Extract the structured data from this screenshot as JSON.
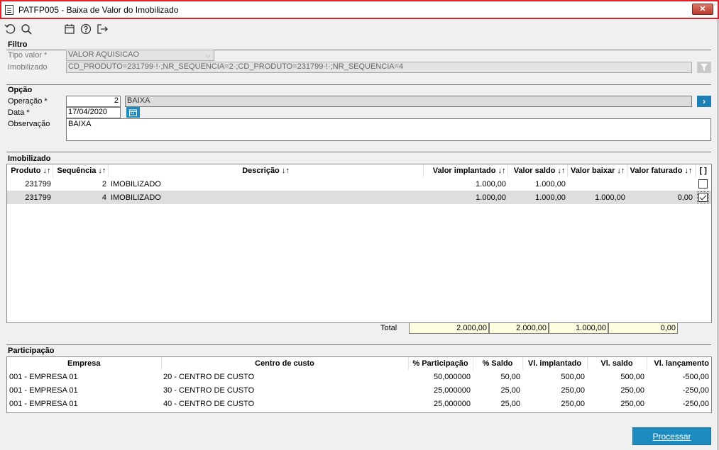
{
  "window": {
    "title": "PATFP005 - Baixa de Valor do Imobilizado",
    "close_label": "✕"
  },
  "toolbar": {
    "icons": [
      "undo-icon",
      "search-icon",
      "calendar-icon",
      "help-icon",
      "exit-icon"
    ]
  },
  "filtro": {
    "section_title": "Filtro",
    "tipo_valor_label": "Tipo valor *",
    "tipo_valor_value": "VALOR AQUISICAO",
    "imobilizado_label": "Imobilizado",
    "imobilizado_value": "CD_PRODUTO=231799·!·;NR_SEQUENCIA=2·;CD_PRODUTO=231799·!·;NR_SEQUENCIA=4"
  },
  "opcao": {
    "section_title": "Opção",
    "operacao_label": "Operação *",
    "operacao_code": "2",
    "operacao_desc": "BAIXA",
    "data_label": "Data *",
    "data_value": "17/04/2020",
    "observacao_label": "Observação",
    "observacao_value": "BAIXA"
  },
  "imobilizado": {
    "section_title": "Imobilizado",
    "columns": [
      "Produto ↓↑",
      "Sequência ↓↑",
      "Descrição ↓↑",
      "Valor implantado ↓↑",
      "Valor saldo ↓↑",
      "Valor baixar ↓↑",
      "Valor faturado ↓↑",
      "[ ]"
    ],
    "rows": [
      {
        "produto": "231799",
        "sequencia": "2",
        "descricao": "IMOBILIZADO",
        "valor_implantado": "1.000,00",
        "valor_saldo": "1.000,00",
        "valor_baixar": "",
        "valor_faturado": "",
        "checked": false
      },
      {
        "produto": "231799",
        "sequencia": "4",
        "descricao": "IMOBILIZADO",
        "valor_implantado": "1.000,00",
        "valor_saldo": "1.000,00",
        "valor_baixar": "1.000,00",
        "valor_faturado": "0,00",
        "checked": true
      }
    ],
    "total_label": "Total",
    "totals": [
      "2.000,00",
      "2.000,00",
      "1.000,00",
      "0,00"
    ]
  },
  "participacao": {
    "section_title": "Participação",
    "columns": [
      "Empresa",
      "Centro de custo",
      "% Participação",
      "% Saldo",
      "Vl. implantado",
      "Vl. saldo",
      "Vl. lançamento"
    ],
    "rows": [
      {
        "empresa": "001 - EMPRESA 01",
        "centro": "20 - CENTRO DE CUSTO",
        "participacao": "50,000000",
        "saldo_pct": "50,00",
        "implantado": "500,00",
        "saldo": "500,00",
        "lancamento": "-500,00"
      },
      {
        "empresa": "001 - EMPRESA 01",
        "centro": "30 - CENTRO DE CUSTO",
        "participacao": "25,000000",
        "saldo_pct": "25,00",
        "implantado": "250,00",
        "saldo": "250,00",
        "lancamento": "-250,00"
      },
      {
        "empresa": "001 - EMPRESA 01",
        "centro": "40 - CENTRO DE CUSTO",
        "participacao": "25,000000",
        "saldo_pct": "25,00",
        "implantado": "250,00",
        "saldo": "250,00",
        "lancamento": "-250,00"
      }
    ]
  },
  "actions": {
    "processar_label": "Processar"
  },
  "colors": {
    "title_border": "#e0202a",
    "accent": "#1c8cc0",
    "total_bg": "#fffde0"
  }
}
